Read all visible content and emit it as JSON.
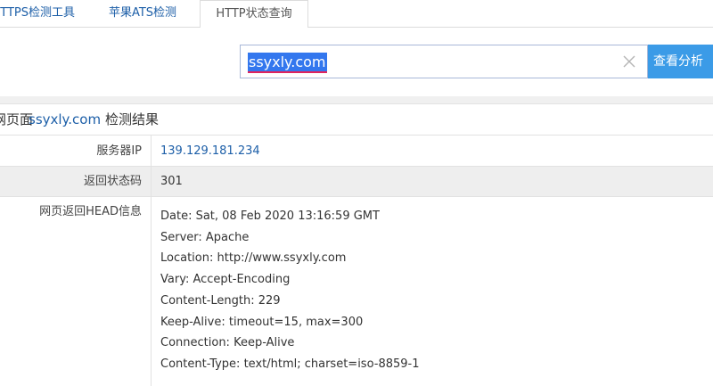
{
  "tabs": [
    {
      "label": "HTTPS检测工具"
    },
    {
      "label": "苹果ATS检测"
    },
    {
      "label": "HTTP状态查询"
    }
  ],
  "search": {
    "value": "ssyxly.com",
    "button_label": "查看分析"
  },
  "result": {
    "title_prefix": "网页面",
    "title_domain": "ssyxly.com",
    "title_suffix": "检测结果",
    "server_ip_label": "服务器IP",
    "server_ip": "139.129.181.234",
    "status_code_label": "返回状态码",
    "status_code": "301",
    "head_label": "网页返回HEAD信息",
    "head_lines": [
      "Date: Sat, 08 Feb 2020 13:16:59 GMT",
      "Server: Apache",
      "Location: http://www.ssyxly.com",
      "Vary: Accept-Encoding",
      "Content-Length: 229",
      "Keep-Alive: timeout=15, max=300",
      "Connection: Keep-Alive",
      "Content-Type: text/html; charset=iso-8859-1"
    ]
  },
  "colors": {
    "accent": "#3b9be7",
    "link": "#1d5fa8",
    "selection": "#3377ee"
  }
}
